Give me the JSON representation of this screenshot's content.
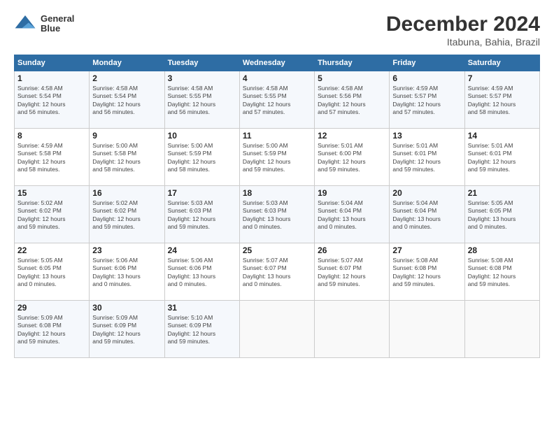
{
  "header": {
    "logo_line1": "General",
    "logo_line2": "Blue",
    "month": "December 2024",
    "location": "Itabuna, Bahia, Brazil"
  },
  "weekdays": [
    "Sunday",
    "Monday",
    "Tuesday",
    "Wednesday",
    "Thursday",
    "Friday",
    "Saturday"
  ],
  "weeks": [
    [
      {
        "day": "1",
        "info": "Sunrise: 4:58 AM\nSunset: 5:54 PM\nDaylight: 12 hours\nand 56 minutes."
      },
      {
        "day": "2",
        "info": "Sunrise: 4:58 AM\nSunset: 5:54 PM\nDaylight: 12 hours\nand 56 minutes."
      },
      {
        "day": "3",
        "info": "Sunrise: 4:58 AM\nSunset: 5:55 PM\nDaylight: 12 hours\nand 56 minutes."
      },
      {
        "day": "4",
        "info": "Sunrise: 4:58 AM\nSunset: 5:55 PM\nDaylight: 12 hours\nand 57 minutes."
      },
      {
        "day": "5",
        "info": "Sunrise: 4:58 AM\nSunset: 5:56 PM\nDaylight: 12 hours\nand 57 minutes."
      },
      {
        "day": "6",
        "info": "Sunrise: 4:59 AM\nSunset: 5:57 PM\nDaylight: 12 hours\nand 57 minutes."
      },
      {
        "day": "7",
        "info": "Sunrise: 4:59 AM\nSunset: 5:57 PM\nDaylight: 12 hours\nand 58 minutes."
      }
    ],
    [
      {
        "day": "8",
        "info": "Sunrise: 4:59 AM\nSunset: 5:58 PM\nDaylight: 12 hours\nand 58 minutes."
      },
      {
        "day": "9",
        "info": "Sunrise: 5:00 AM\nSunset: 5:58 PM\nDaylight: 12 hours\nand 58 minutes."
      },
      {
        "day": "10",
        "info": "Sunrise: 5:00 AM\nSunset: 5:59 PM\nDaylight: 12 hours\nand 58 minutes."
      },
      {
        "day": "11",
        "info": "Sunrise: 5:00 AM\nSunset: 5:59 PM\nDaylight: 12 hours\nand 59 minutes."
      },
      {
        "day": "12",
        "info": "Sunrise: 5:01 AM\nSunset: 6:00 PM\nDaylight: 12 hours\nand 59 minutes."
      },
      {
        "day": "13",
        "info": "Sunrise: 5:01 AM\nSunset: 6:01 PM\nDaylight: 12 hours\nand 59 minutes."
      },
      {
        "day": "14",
        "info": "Sunrise: 5:01 AM\nSunset: 6:01 PM\nDaylight: 12 hours\nand 59 minutes."
      }
    ],
    [
      {
        "day": "15",
        "info": "Sunrise: 5:02 AM\nSunset: 6:02 PM\nDaylight: 12 hours\nand 59 minutes."
      },
      {
        "day": "16",
        "info": "Sunrise: 5:02 AM\nSunset: 6:02 PM\nDaylight: 12 hours\nand 59 minutes."
      },
      {
        "day": "17",
        "info": "Sunrise: 5:03 AM\nSunset: 6:03 PM\nDaylight: 12 hours\nand 59 minutes."
      },
      {
        "day": "18",
        "info": "Sunrise: 5:03 AM\nSunset: 6:03 PM\nDaylight: 13 hours\nand 0 minutes."
      },
      {
        "day": "19",
        "info": "Sunrise: 5:04 AM\nSunset: 6:04 PM\nDaylight: 13 hours\nand 0 minutes."
      },
      {
        "day": "20",
        "info": "Sunrise: 5:04 AM\nSunset: 6:04 PM\nDaylight: 13 hours\nand 0 minutes."
      },
      {
        "day": "21",
        "info": "Sunrise: 5:05 AM\nSunset: 6:05 PM\nDaylight: 13 hours\nand 0 minutes."
      }
    ],
    [
      {
        "day": "22",
        "info": "Sunrise: 5:05 AM\nSunset: 6:05 PM\nDaylight: 13 hours\nand 0 minutes."
      },
      {
        "day": "23",
        "info": "Sunrise: 5:06 AM\nSunset: 6:06 PM\nDaylight: 13 hours\nand 0 minutes."
      },
      {
        "day": "24",
        "info": "Sunrise: 5:06 AM\nSunset: 6:06 PM\nDaylight: 13 hours\nand 0 minutes."
      },
      {
        "day": "25",
        "info": "Sunrise: 5:07 AM\nSunset: 6:07 PM\nDaylight: 13 hours\nand 0 minutes."
      },
      {
        "day": "26",
        "info": "Sunrise: 5:07 AM\nSunset: 6:07 PM\nDaylight: 12 hours\nand 59 minutes."
      },
      {
        "day": "27",
        "info": "Sunrise: 5:08 AM\nSunset: 6:08 PM\nDaylight: 12 hours\nand 59 minutes."
      },
      {
        "day": "28",
        "info": "Sunrise: 5:08 AM\nSunset: 6:08 PM\nDaylight: 12 hours\nand 59 minutes."
      }
    ],
    [
      {
        "day": "29",
        "info": "Sunrise: 5:09 AM\nSunset: 6:08 PM\nDaylight: 12 hours\nand 59 minutes."
      },
      {
        "day": "30",
        "info": "Sunrise: 5:09 AM\nSunset: 6:09 PM\nDaylight: 12 hours\nand 59 minutes."
      },
      {
        "day": "31",
        "info": "Sunrise: 5:10 AM\nSunset: 6:09 PM\nDaylight: 12 hours\nand 59 minutes."
      },
      {
        "day": "",
        "info": ""
      },
      {
        "day": "",
        "info": ""
      },
      {
        "day": "",
        "info": ""
      },
      {
        "day": "",
        "info": ""
      }
    ]
  ]
}
